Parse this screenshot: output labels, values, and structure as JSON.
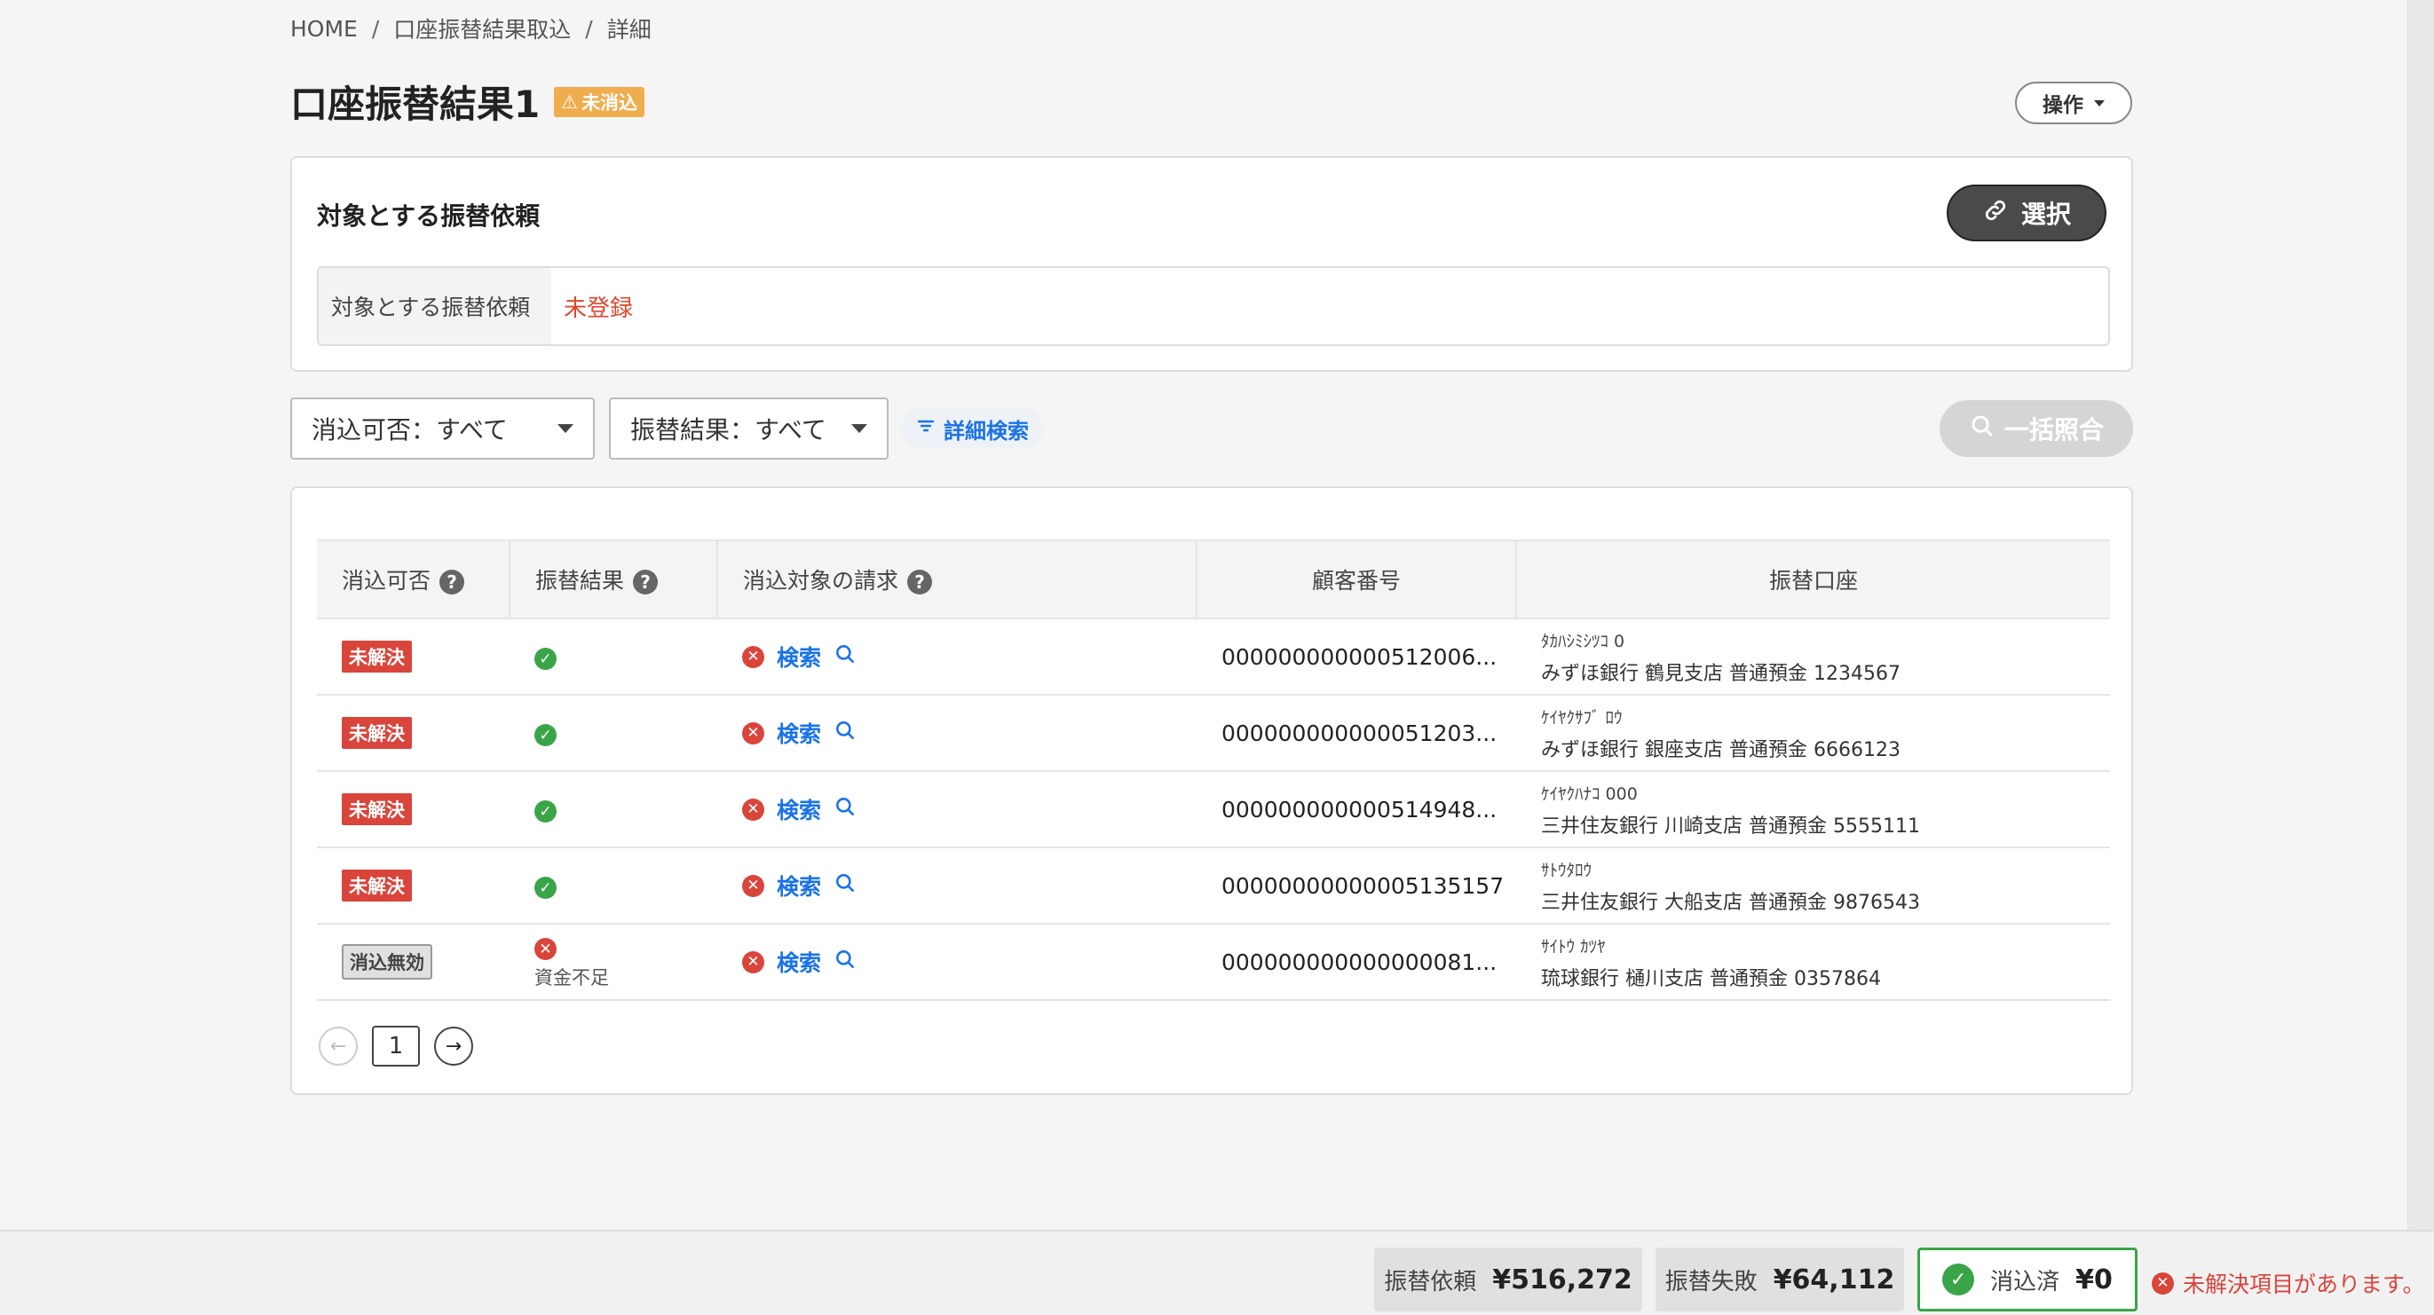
{
  "breadcrumb": {
    "home": "HOME",
    "sep": "/",
    "import": "口座振替結果取込",
    "detail": "詳細"
  },
  "header": {
    "title": "口座振替結果1",
    "status_badge": "未消込",
    "ops_label": "操作"
  },
  "target": {
    "title": "対象とする振替依頼",
    "select_label": "選択",
    "field_label": "対象とする振替依頼",
    "field_value": "未登録"
  },
  "filters": {
    "reconcile": "消込可否：すべて",
    "result": "振替結果：すべて",
    "advanced": "詳細検索",
    "bulk": "一括照合"
  },
  "table": {
    "headers": {
      "reconcile": "消込可否",
      "result": "振替結果",
      "target_invoice": "消込対象の請求",
      "customer_no": "顧客番号",
      "account": "振替口座"
    },
    "search_label": "検索",
    "rows": [
      {
        "status": "未解決",
        "status_kind": "red",
        "result": "ok",
        "result_note": "",
        "customer_no": "000000000000512006...",
        "kana": "ﾀｶﾊｼﾐｼﾂｺ 0",
        "bank": "みずほ銀行 鶴見支店 普通預金 1234567"
      },
      {
        "status": "未解決",
        "status_kind": "red",
        "result": "ok",
        "result_note": "",
        "customer_no": "000000000000051203...",
        "kana": "ｹｲﾔｸｻﾌﾞ ﾛｳ",
        "bank": "みずほ銀行 銀座支店 普通預金 6666123"
      },
      {
        "status": "未解決",
        "status_kind": "red",
        "result": "ok",
        "result_note": "",
        "customer_no": "000000000000514948...",
        "kana": "ｹｲﾔｸﾊﾅｺ 000",
        "bank": "三井住友銀行 川崎支店 普通預金 5555111"
      },
      {
        "status": "未解決",
        "status_kind": "red",
        "result": "ok",
        "result_note": "",
        "customer_no": "00000000000005135157",
        "kana": "ｻﾄｳﾀﾛｳ",
        "bank": "三井住友銀行 大船支店 普通預金 9876543"
      },
      {
        "status": "消込無効",
        "status_kind": "gray",
        "result": "ng",
        "result_note": "資金不足",
        "customer_no": "000000000000000081...",
        "kana": "ｻｲﾄｳ ｶﾂﾔ",
        "bank": "琉球銀行 樋川支店 普通預金 0357864"
      }
    ]
  },
  "pagination": {
    "current": "1"
  },
  "footer": {
    "requested_label": "振替依頼",
    "requested_amount": "¥516,272",
    "failed_label": "振替失敗",
    "failed_amount": "¥64,112",
    "reconciled_label": "消込済",
    "reconciled_amount": "¥0",
    "message": "未解決項目があります。"
  },
  "colors": {
    "accent": "#1a73e8",
    "danger": "#d9453b",
    "success": "#3aa548",
    "warning": "#f0ad4e"
  }
}
